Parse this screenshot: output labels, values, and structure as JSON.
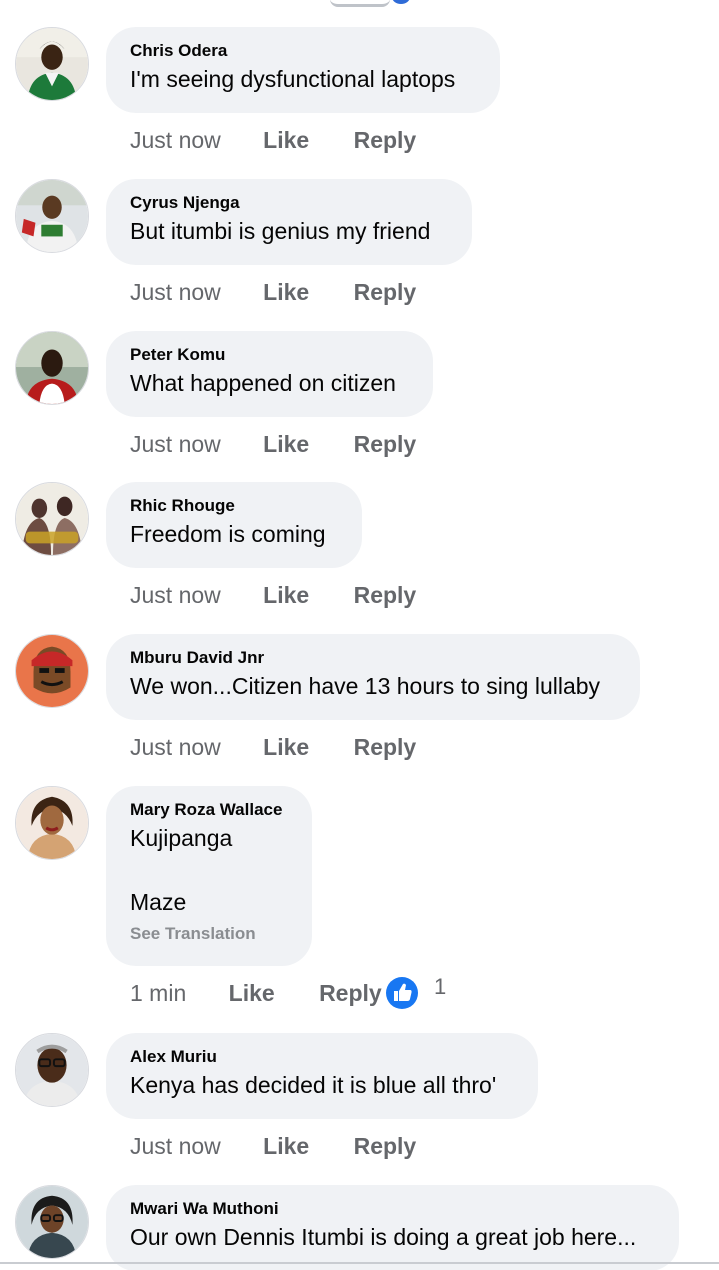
{
  "comments": [
    {
      "author": "Chris Odera",
      "text": "I'm seeing dysfunctional laptops",
      "time": "Just now",
      "like": "Like",
      "reply": "Reply"
    },
    {
      "author": "Cyrus Njenga",
      "text": "But itumbi is genius my friend",
      "time": "Just now",
      "like": "Like",
      "reply": "Reply"
    },
    {
      "author": "Peter Komu",
      "text": "What happened on citizen",
      "time": "Just now",
      "like": "Like",
      "reply": "Reply"
    },
    {
      "author": "Rhic Rhouge",
      "text": "Freedom is coming",
      "time": "Just now",
      "like": "Like",
      "reply": "Reply"
    },
    {
      "author": "Mburu David Jnr",
      "text": "We won...Citizen have 13 hours to sing lullaby",
      "time": "Just now",
      "like": "Like",
      "reply": "Reply"
    },
    {
      "author": "Mary Roza Wallace",
      "text_line1": "Kujipanga",
      "text_line2": "Maze",
      "see_translation": "See Translation",
      "time": "1 min",
      "like": "Like",
      "reply": "Reply",
      "reaction_icon": "thumbs-up-icon",
      "reaction_count": "1"
    },
    {
      "author": "Alex Muriu",
      "text": "Kenya has decided it is blue all thro'",
      "time": "Just now",
      "like": "Like",
      "reply": "Reply"
    },
    {
      "author": "Mwari Wa Muthoni",
      "text": "Our own Dennis Itumbi is doing a great job here...",
      "time": "",
      "like": "",
      "reply": ""
    }
  ],
  "colors": {
    "bubble": "#f0f2f5",
    "muted_text": "#65676b",
    "like_blue": "#1877f2"
  }
}
